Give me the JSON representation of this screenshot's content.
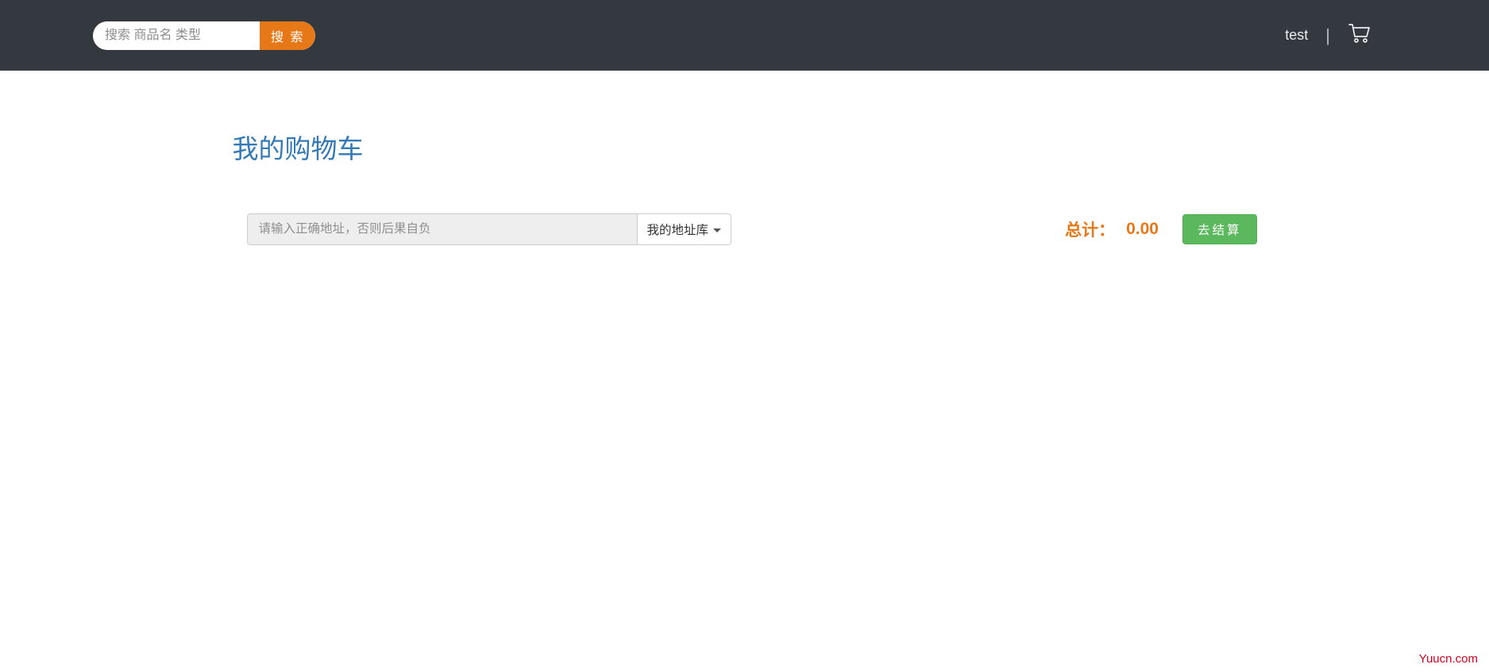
{
  "header": {
    "search_placeholder": "搜索 商品名 类型",
    "search_button": "搜 索",
    "user_name": "test"
  },
  "main": {
    "page_title": "我的购物车",
    "address_placeholder": "请输入正确地址，否则后果自负",
    "address_dropdown_label": "我的地址库",
    "total_label": "总计：",
    "total_value": "0.00",
    "checkout_button": "去结算"
  },
  "footer": {
    "watermark": "Yuucn.com"
  }
}
